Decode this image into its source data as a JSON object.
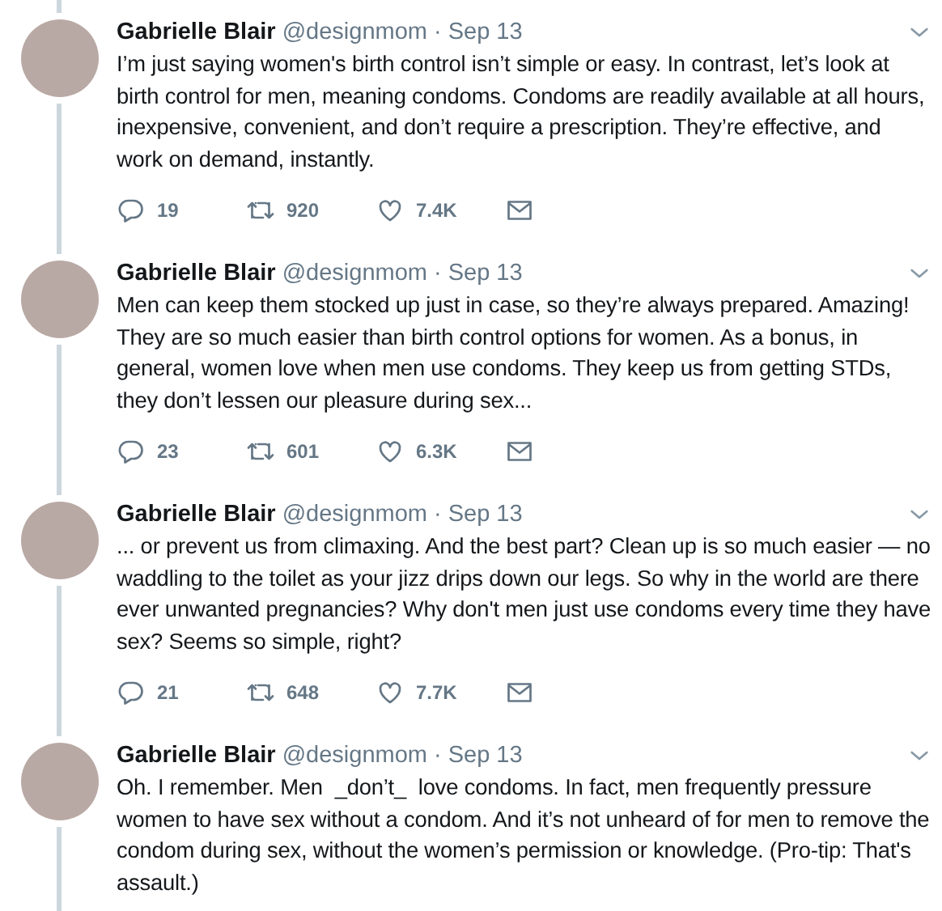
{
  "tweets": [
    {
      "name": "Gabrielle Blair",
      "handle": "@designmom",
      "separator": "·",
      "date": "Sep 13",
      "text": "I’m just saying women's birth control isn’t simple or easy. In contrast, let’s look at birth control for men, meaning condoms. Condoms are readily available at all hours, inexpensive, convenient, and don’t require a prescription. They’re effective, and work on demand, instantly.",
      "replies": "19",
      "retweets": "920",
      "likes": "7.4K"
    },
    {
      "name": "Gabrielle Blair",
      "handle": "@designmom",
      "separator": "·",
      "date": "Sep 13",
      "text": "Men can keep them stocked up just in case, so they’re always prepared. Amazing! They are so much easier than birth control options for women. As a bonus, in general, women love when men use condoms. They keep us from getting STDs, they don’t lessen our pleasure during sex...",
      "replies": "23",
      "retweets": "601",
      "likes": "6.3K"
    },
    {
      "name": "Gabrielle Blair",
      "handle": "@designmom",
      "separator": "·",
      "date": "Sep 13",
      "text": "... or prevent us from climaxing. And the best part? Clean up is so much easier — no waddling to the toilet as your jizz drips down our legs. So why in the world are there ever unwanted pregnancies? Why don't men just use condoms every time they have sex? Seems so simple, right?",
      "replies": "21",
      "retweets": "648",
      "likes": "7.7K"
    },
    {
      "name": "Gabrielle Blair",
      "handle": "@designmom",
      "separator": "·",
      "date": "Sep 13",
      "text": "Oh. I remember. Men  _don’t_  love condoms. In fact, men frequently pressure women to have sex without a condom. And it’s not unheard of for men to remove the condom during sex, without the women’s permission or knowledge. (Pro-tip: That's assault.)"
    }
  ]
}
